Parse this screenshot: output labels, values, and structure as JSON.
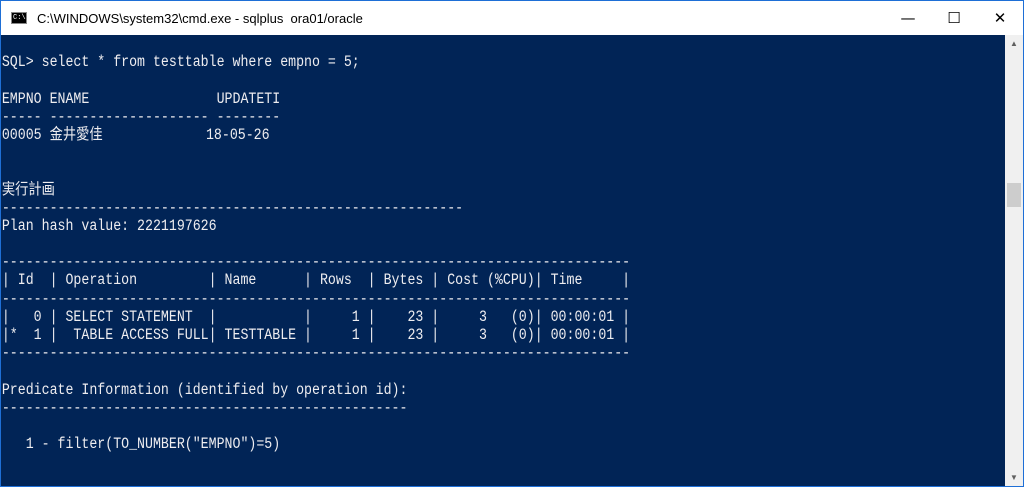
{
  "window": {
    "title": "C:\\WINDOWS\\system32\\cmd.exe - sqlplus  ora01/oracle",
    "icon_text": "C:\\",
    "controls": {
      "minimize": "—",
      "maximize": "☐",
      "close": "✕"
    }
  },
  "console": {
    "lines": [
      "",
      "SQL> select * from testtable where empno = 5;",
      "",
      "EMPNO ENAME                UPDATETI",
      "----- -------------------- --------",
      "00005 金井愛佳             18-05-26",
      "",
      "",
      "実行計画",
      "----------------------------------------------------------",
      "Plan hash value: 2221197626",
      "",
      "-------------------------------------------------------------------------------",
      "| Id  | Operation         | Name      | Rows  | Bytes | Cost (%CPU)| Time     |",
      "-------------------------------------------------------------------------------",
      "|   0 | SELECT STATEMENT  |           |     1 |    23 |     3   (0)| 00:00:01 |",
      "|*  1 |  TABLE ACCESS FULL| TESTTABLE |     1 |    23 |     3   (0)| 00:00:01 |",
      "-------------------------------------------------------------------------------",
      "",
      "Predicate Information (identified by operation id):",
      "---------------------------------------------------",
      "",
      "   1 - filter(TO_NUMBER(\"EMPNO\")=5)",
      ""
    ]
  },
  "colors": {
    "console_bg": "#012456",
    "console_fg": "#eeedf0"
  }
}
